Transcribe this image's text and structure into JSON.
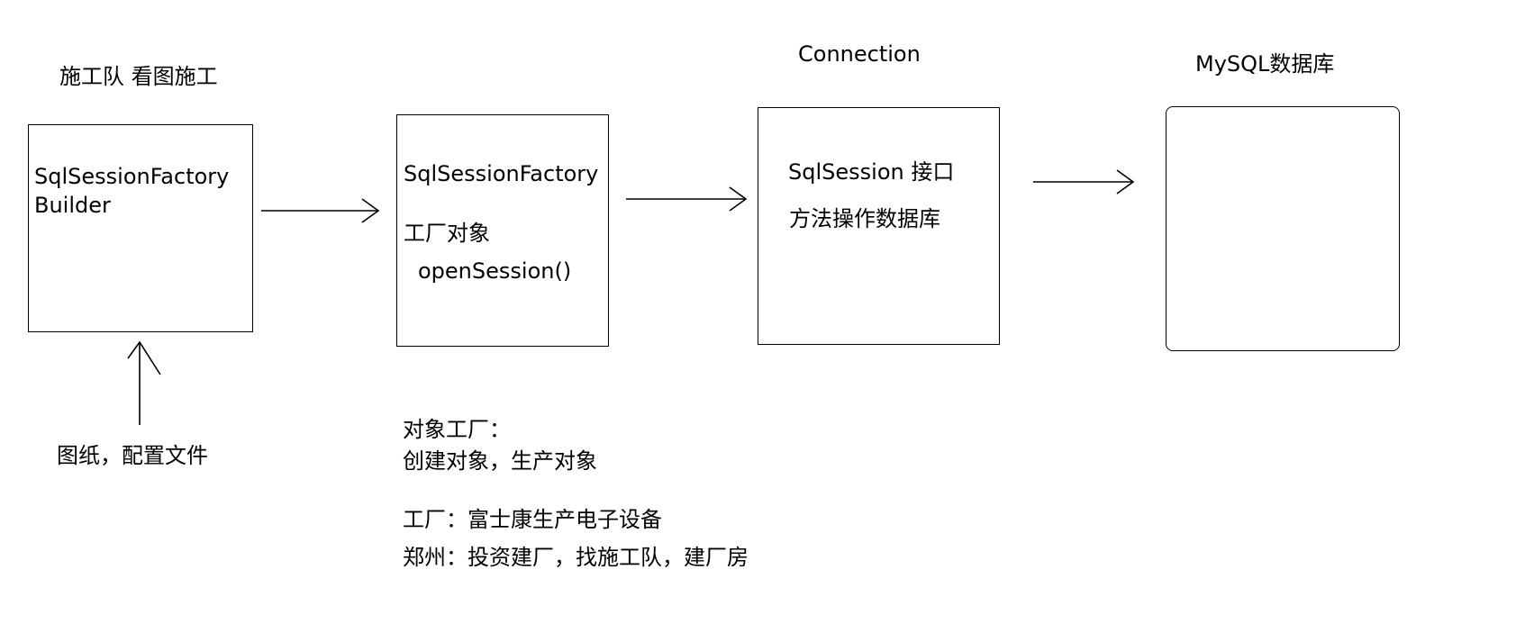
{
  "labels": {
    "builder_caption": "施工队 看图施工",
    "connection_caption": "Connection",
    "db_caption": "MySQL数据库",
    "config_caption": "图纸，配置文件"
  },
  "builder_box": {
    "line1": "SqlSessionFactory",
    "line2": "Builder"
  },
  "factory_box": {
    "title": "SqlSessionFactory",
    "desc": "工厂对象",
    "method": "openSession()"
  },
  "session_box": {
    "title": "SqlSession 接口",
    "desc": "方法操作数据库"
  },
  "notes": [
    "对象工厂：",
    "创建对象，生产对象",
    "工厂：富士康生产电子设备",
    "郑州：投资建厂，找施工队，建厂房"
  ],
  "colors": {
    "stroke": "#000000",
    "background": "#ffffff"
  }
}
